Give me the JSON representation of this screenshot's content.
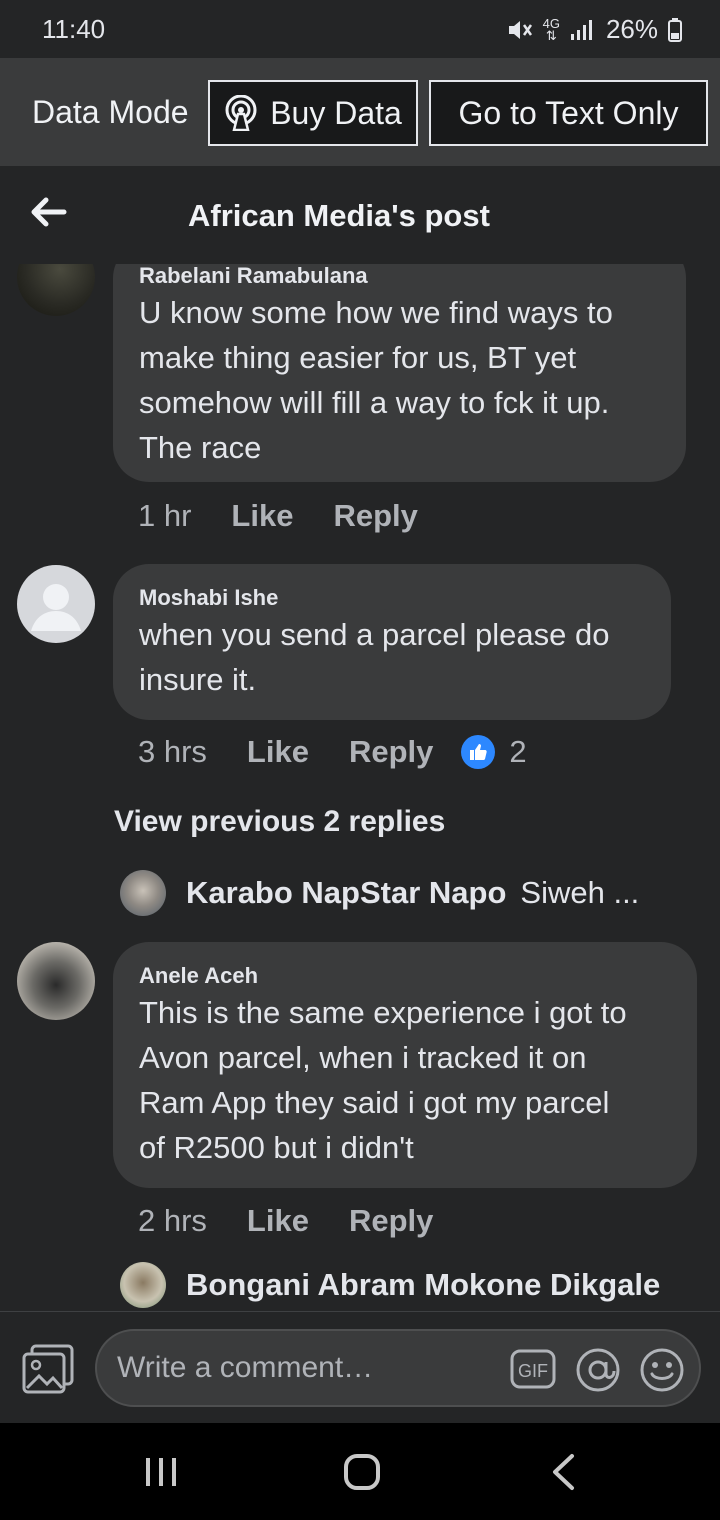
{
  "status_bar": {
    "time": "11:40",
    "battery": "26%",
    "network": "4G"
  },
  "data_bar": {
    "mode_label": "Data Mode",
    "buy_label": "Buy Data",
    "text_only_label": "Go to Text Only"
  },
  "header": {
    "title": "African Media's post"
  },
  "comments": [
    {
      "author": "Rabelani Ramabulana",
      "lines": [
        "U know some how we find ways to",
        "make thing easier for us, BT yet",
        "somehow will fill a way to fck it up.",
        "The race"
      ],
      "time": "1 hr",
      "like": "Like",
      "reply": "Reply"
    },
    {
      "author": "Moshabi Ishe",
      "lines": [
        "when you send a parcel please do",
        "insure it."
      ],
      "time": "3 hrs",
      "like": "Like",
      "reply": "Reply",
      "reaction_count": "2",
      "view_replies": "View previous 2 replies",
      "reply_preview": {
        "author": "Karabo NapStar Napo",
        "snippet": "Siweh ..."
      }
    },
    {
      "author": "Anele Aceh",
      "lines": [
        "This is the same experience i got to",
        "Avon parcel, when i tracked it on",
        "Ram App they said i got my parcel",
        "of R2500 but i didn't"
      ],
      "time": "2 hrs",
      "like": "Like",
      "reply": "Reply",
      "reply_preview": {
        "author": "Bongani Abram Mokone Dikgale"
      }
    }
  ],
  "composer": {
    "placeholder": "Write a comment…",
    "gif_label": "GIF"
  },
  "colors": {
    "background": "#242526",
    "bubble": "#3a3b3c",
    "accent_like": "#2d88ff",
    "text": "#e4e6eb",
    "muted": "#b0b3b8"
  }
}
